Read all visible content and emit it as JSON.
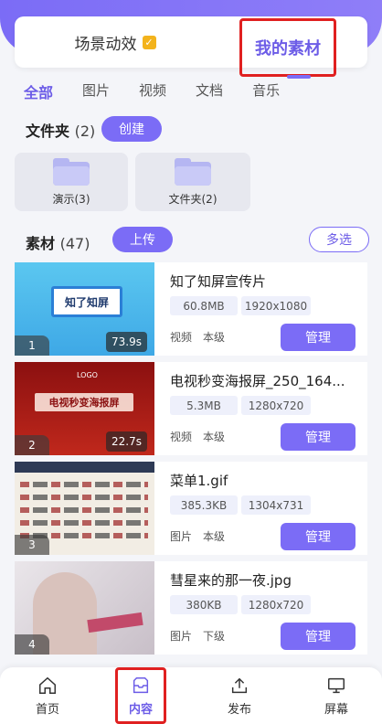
{
  "top_tabs": {
    "scene": "场景动效",
    "scene_badge": "✓",
    "mine": "我的素材"
  },
  "filters": [
    "全部",
    "图片",
    "视频",
    "文档",
    "音乐"
  ],
  "folder_section": {
    "title": "文件夹",
    "count": "(2)",
    "create": "创建"
  },
  "folders": [
    {
      "label": "演示(3)"
    },
    {
      "label": "文件夹(2)"
    }
  ],
  "material_section": {
    "title": "素材",
    "count": "(47)",
    "upload": "上传",
    "multi": "多选"
  },
  "materials": [
    {
      "index": "1",
      "name": "知了知屏宣传片",
      "size": "60.8MB",
      "res": "1920x1080",
      "type": "视频",
      "level": "本级",
      "duration": "73.9s",
      "manage": "管理",
      "thumb_text": "知了知屏"
    },
    {
      "index": "2",
      "name": "电视秒变海报屏_250_164...",
      "size": "5.3MB",
      "res": "1280x720",
      "type": "视频",
      "level": "本级",
      "duration": "22.7s",
      "manage": "管理",
      "thumb_text": "电视秒变海报屏",
      "logo": "LOGO"
    },
    {
      "index": "3",
      "name": "菜单1.gif",
      "size": "385.3KB",
      "res": "1304x731",
      "type": "图片",
      "level": "本级",
      "manage": "管理"
    },
    {
      "index": "4",
      "name": "彗星来的那一夜.jpg",
      "size": "380KB",
      "res": "1280x720",
      "type": "图片",
      "level": "下级",
      "manage": "管理"
    }
  ],
  "bottom_nav": {
    "home": "首页",
    "content": "内容",
    "publish": "发布",
    "screen": "屏幕"
  },
  "colors": {
    "accent": "#7b6cf6",
    "highlight": "#e02020"
  }
}
